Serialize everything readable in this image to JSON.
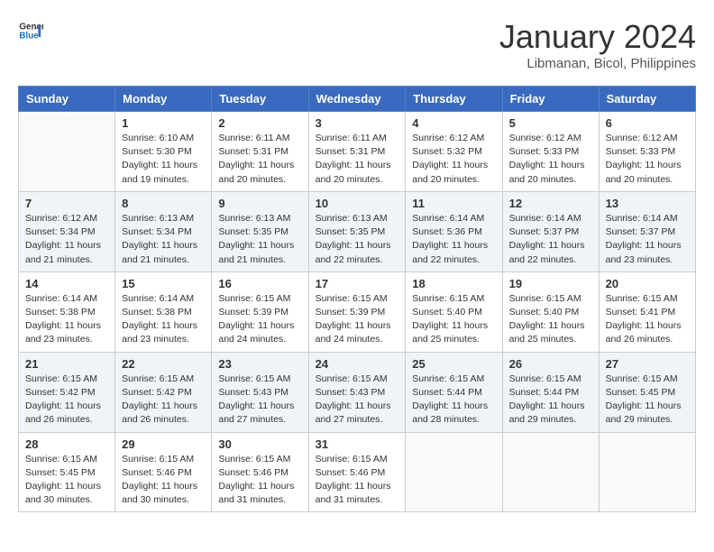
{
  "header": {
    "logo_line1": "General",
    "logo_line2": "Blue",
    "month_year": "January 2024",
    "location": "Libmanan, Bicol, Philippines"
  },
  "days_of_week": [
    "Sunday",
    "Monday",
    "Tuesday",
    "Wednesday",
    "Thursday",
    "Friday",
    "Saturday"
  ],
  "weeks": [
    [
      {
        "num": "",
        "info": ""
      },
      {
        "num": "1",
        "info": "Sunrise: 6:10 AM\nSunset: 5:30 PM\nDaylight: 11 hours\nand 19 minutes."
      },
      {
        "num": "2",
        "info": "Sunrise: 6:11 AM\nSunset: 5:31 PM\nDaylight: 11 hours\nand 20 minutes."
      },
      {
        "num": "3",
        "info": "Sunrise: 6:11 AM\nSunset: 5:31 PM\nDaylight: 11 hours\nand 20 minutes."
      },
      {
        "num": "4",
        "info": "Sunrise: 6:12 AM\nSunset: 5:32 PM\nDaylight: 11 hours\nand 20 minutes."
      },
      {
        "num": "5",
        "info": "Sunrise: 6:12 AM\nSunset: 5:33 PM\nDaylight: 11 hours\nand 20 minutes."
      },
      {
        "num": "6",
        "info": "Sunrise: 6:12 AM\nSunset: 5:33 PM\nDaylight: 11 hours\nand 20 minutes."
      }
    ],
    [
      {
        "num": "7",
        "info": "Sunrise: 6:12 AM\nSunset: 5:34 PM\nDaylight: 11 hours\nand 21 minutes."
      },
      {
        "num": "8",
        "info": "Sunrise: 6:13 AM\nSunset: 5:34 PM\nDaylight: 11 hours\nand 21 minutes."
      },
      {
        "num": "9",
        "info": "Sunrise: 6:13 AM\nSunset: 5:35 PM\nDaylight: 11 hours\nand 21 minutes."
      },
      {
        "num": "10",
        "info": "Sunrise: 6:13 AM\nSunset: 5:35 PM\nDaylight: 11 hours\nand 22 minutes."
      },
      {
        "num": "11",
        "info": "Sunrise: 6:14 AM\nSunset: 5:36 PM\nDaylight: 11 hours\nand 22 minutes."
      },
      {
        "num": "12",
        "info": "Sunrise: 6:14 AM\nSunset: 5:37 PM\nDaylight: 11 hours\nand 22 minutes."
      },
      {
        "num": "13",
        "info": "Sunrise: 6:14 AM\nSunset: 5:37 PM\nDaylight: 11 hours\nand 23 minutes."
      }
    ],
    [
      {
        "num": "14",
        "info": "Sunrise: 6:14 AM\nSunset: 5:38 PM\nDaylight: 11 hours\nand 23 minutes."
      },
      {
        "num": "15",
        "info": "Sunrise: 6:14 AM\nSunset: 5:38 PM\nDaylight: 11 hours\nand 23 minutes."
      },
      {
        "num": "16",
        "info": "Sunrise: 6:15 AM\nSunset: 5:39 PM\nDaylight: 11 hours\nand 24 minutes."
      },
      {
        "num": "17",
        "info": "Sunrise: 6:15 AM\nSunset: 5:39 PM\nDaylight: 11 hours\nand 24 minutes."
      },
      {
        "num": "18",
        "info": "Sunrise: 6:15 AM\nSunset: 5:40 PM\nDaylight: 11 hours\nand 25 minutes."
      },
      {
        "num": "19",
        "info": "Sunrise: 6:15 AM\nSunset: 5:40 PM\nDaylight: 11 hours\nand 25 minutes."
      },
      {
        "num": "20",
        "info": "Sunrise: 6:15 AM\nSunset: 5:41 PM\nDaylight: 11 hours\nand 26 minutes."
      }
    ],
    [
      {
        "num": "21",
        "info": "Sunrise: 6:15 AM\nSunset: 5:42 PM\nDaylight: 11 hours\nand 26 minutes."
      },
      {
        "num": "22",
        "info": "Sunrise: 6:15 AM\nSunset: 5:42 PM\nDaylight: 11 hours\nand 26 minutes."
      },
      {
        "num": "23",
        "info": "Sunrise: 6:15 AM\nSunset: 5:43 PM\nDaylight: 11 hours\nand 27 minutes."
      },
      {
        "num": "24",
        "info": "Sunrise: 6:15 AM\nSunset: 5:43 PM\nDaylight: 11 hours\nand 27 minutes."
      },
      {
        "num": "25",
        "info": "Sunrise: 6:15 AM\nSunset: 5:44 PM\nDaylight: 11 hours\nand 28 minutes."
      },
      {
        "num": "26",
        "info": "Sunrise: 6:15 AM\nSunset: 5:44 PM\nDaylight: 11 hours\nand 29 minutes."
      },
      {
        "num": "27",
        "info": "Sunrise: 6:15 AM\nSunset: 5:45 PM\nDaylight: 11 hours\nand 29 minutes."
      }
    ],
    [
      {
        "num": "28",
        "info": "Sunrise: 6:15 AM\nSunset: 5:45 PM\nDaylight: 11 hours\nand 30 minutes."
      },
      {
        "num": "29",
        "info": "Sunrise: 6:15 AM\nSunset: 5:46 PM\nDaylight: 11 hours\nand 30 minutes."
      },
      {
        "num": "30",
        "info": "Sunrise: 6:15 AM\nSunset: 5:46 PM\nDaylight: 11 hours\nand 31 minutes."
      },
      {
        "num": "31",
        "info": "Sunrise: 6:15 AM\nSunset: 5:46 PM\nDaylight: 11 hours\nand 31 minutes."
      },
      {
        "num": "",
        "info": ""
      },
      {
        "num": "",
        "info": ""
      },
      {
        "num": "",
        "info": ""
      }
    ]
  ]
}
